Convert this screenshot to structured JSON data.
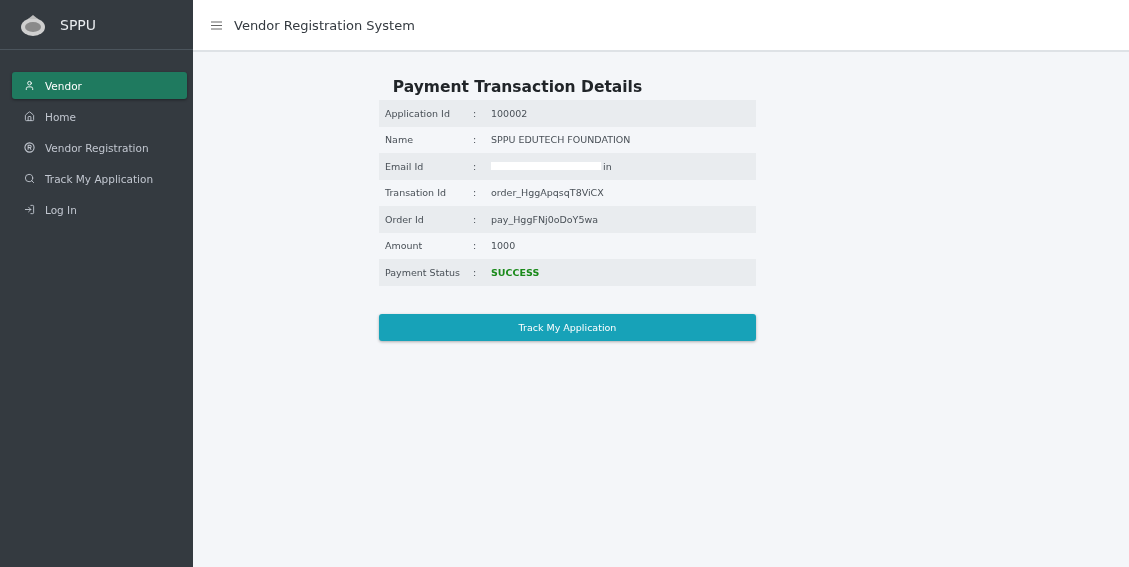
{
  "sidebar": {
    "brand": "SPPU",
    "items": [
      {
        "label": "Vendor",
        "selected": true
      },
      {
        "label": "Home",
        "selected": false
      },
      {
        "label": "Vendor Registration",
        "selected": false
      },
      {
        "label": "Track My Application",
        "selected": false
      },
      {
        "label": "Log In",
        "selected": false
      }
    ]
  },
  "header": {
    "title": "Vendor Registration System"
  },
  "details": {
    "title": "Payment Transaction Details",
    "rows": [
      {
        "label": "Application Id",
        "value": "100002",
        "kind": "text"
      },
      {
        "label": "Name",
        "value": "SPPU EDUTECH FOUNDATION",
        "kind": "text"
      },
      {
        "label": "Email Id",
        "value": "in",
        "kind": "redacted"
      },
      {
        "label": "Transation Id",
        "value": "order_HggApqsqT8ViCX",
        "kind": "text"
      },
      {
        "label": "Order Id",
        "value": "pay_HggFNj0oDoY5wa",
        "kind": "text"
      },
      {
        "label": "Amount",
        "value": "1000",
        "kind": "text"
      },
      {
        "label": "Payment Status",
        "value": "SUCCESS",
        "kind": "status"
      }
    ],
    "separator": ":"
  },
  "button": {
    "label": "Track My Application"
  }
}
